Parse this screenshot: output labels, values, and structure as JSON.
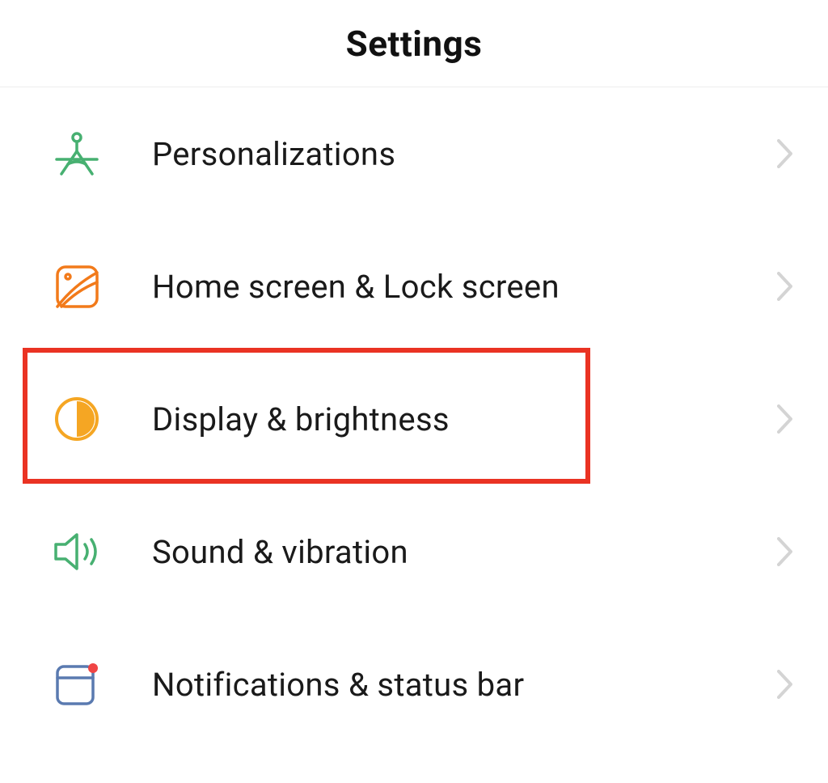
{
  "header": {
    "title": "Settings"
  },
  "items": [
    {
      "icon": "personalizations",
      "label": "Personalizations",
      "highlighted": false
    },
    {
      "icon": "home-lock",
      "label": "Home screen & Lock screen",
      "highlighted": false
    },
    {
      "icon": "display-brightness",
      "label": "Display & brightness",
      "highlighted": true
    },
    {
      "icon": "sound-vibration",
      "label": "Sound & vibration",
      "highlighted": false
    },
    {
      "icon": "notifications-status",
      "label": "Notifications & status bar",
      "highlighted": false
    }
  ],
  "colors": {
    "highlight": "#ea3323",
    "green": "#47b071",
    "orange": "#f27a1a",
    "amber": "#f5a623",
    "blue": "#5a7ab0",
    "red_dot": "#f04545"
  }
}
